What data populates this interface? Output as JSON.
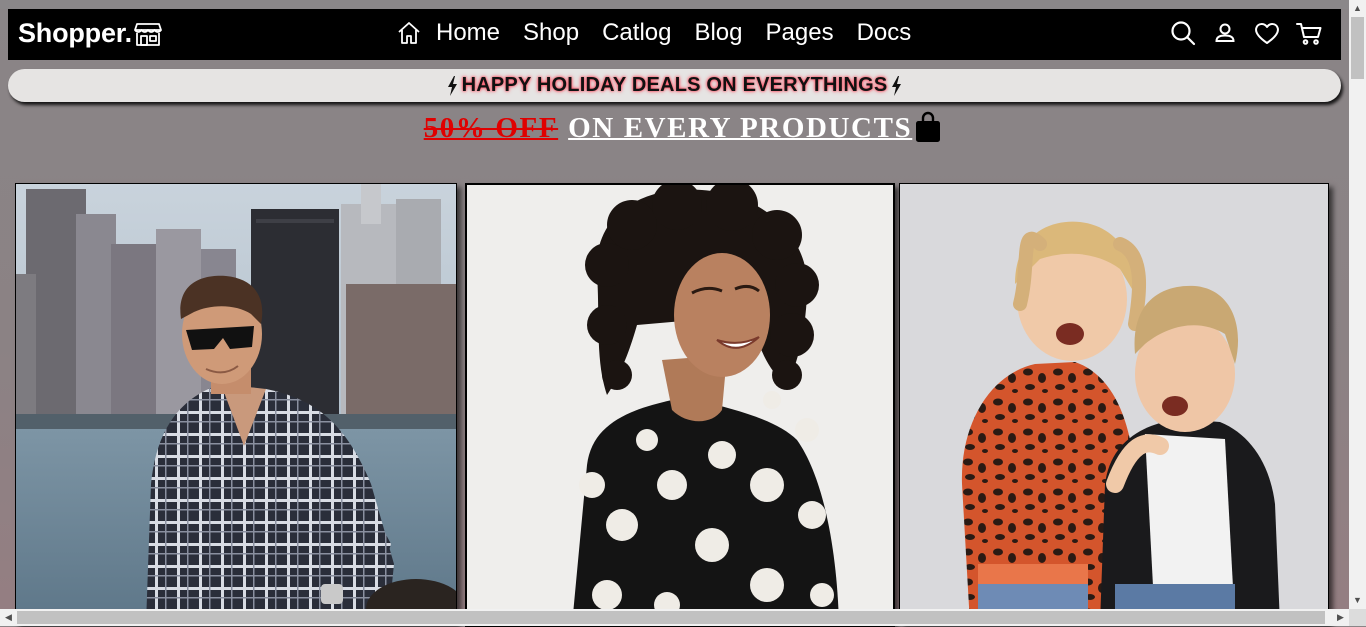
{
  "brand": {
    "name": "Shopper.",
    "icon": "storefront-icon"
  },
  "nav": {
    "home_icon": "home-icon",
    "links": [
      "Home",
      "Shop",
      "Catlog",
      "Blog",
      "Pages",
      "Docs"
    ]
  },
  "actions": [
    "search-icon",
    "user-icon",
    "heart-icon",
    "cart-icon"
  ],
  "promo": {
    "text": "HAPPY HOLIDAY DEALS ON EVERYTHINGS",
    "icon": "lightning-icon",
    "glow_color": "#ff4b5f"
  },
  "headline": {
    "discount": "50% OFF",
    "rest": "ON EVERY PRODUCTS",
    "icon": "shopping-bag-icon",
    "discount_color": "#e00000"
  },
  "cards": [
    {
      "subject": "man-photo"
    },
    {
      "subject": "woman-photo"
    },
    {
      "subject": "kids-photo"
    }
  ],
  "colors": {
    "navbar_bg": "#000000",
    "promo_bg": "#e6e4e3",
    "page_bg": "#8a8587"
  }
}
